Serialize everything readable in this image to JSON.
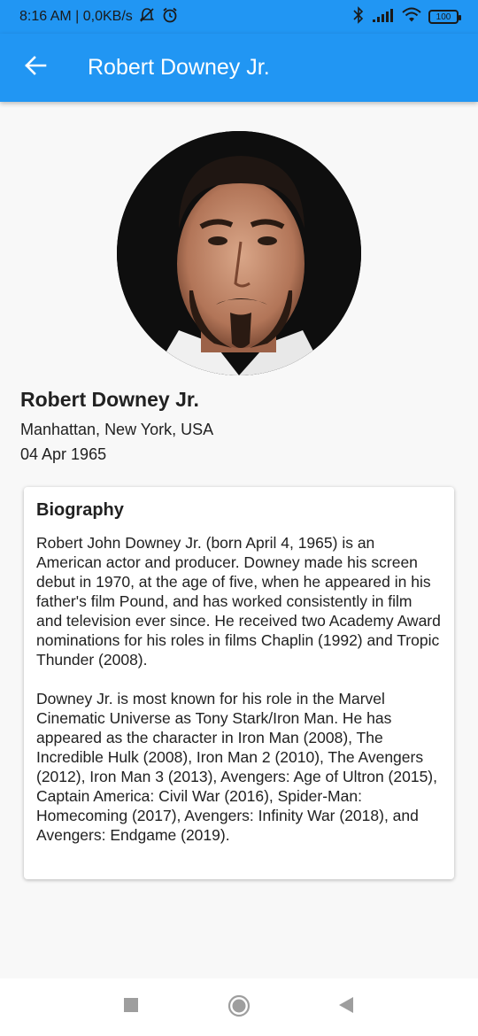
{
  "status_bar": {
    "time_speed": "8:16 AM | 0,0KB/s",
    "battery": "100",
    "icons": [
      "mute-icon",
      "alarm-icon",
      "bluetooth-icon",
      "signal-icon",
      "wifi-icon",
      "battery-icon"
    ]
  },
  "app_bar": {
    "title": "Robert Downey Jr.",
    "back_icon": "arrow-left-icon",
    "color": "#2196f3"
  },
  "profile": {
    "name": "Robert Downey Jr.",
    "place_of_birth": "Manhattan, New York, USA",
    "birthday": "04 Apr 1965"
  },
  "biography": {
    "heading": "Biography",
    "paragraphs": [
      "Robert John Downey Jr. (born April 4, 1965) is an American actor and producer. Downey made his screen debut in 1970, at the age of five, when he appeared in his father's film Pound, and has worked consistently in film and television ever since. He received two Academy Award nominations for his roles in films Chaplin (1992) and Tropic Thunder (2008).",
      "Downey Jr. is most known for his role in the Marvel Cinematic Universe as Tony Stark/Iron Man. He has appeared as the character in Iron Man (2008), The Incredible Hulk (2008), Iron Man 2 (2010), The Avengers (2012), Iron Man 3 (2013), Avengers: Age of Ultron (2015), Captain America: Civil War (2016), Spider-Man: Homecoming (2017), Avengers: Infinity War (2018), and Avengers: Endgame (2019)."
    ]
  },
  "nav_bar": {
    "buttons": [
      "recents-square-icon",
      "home-circle-icon",
      "back-triangle-icon"
    ]
  }
}
